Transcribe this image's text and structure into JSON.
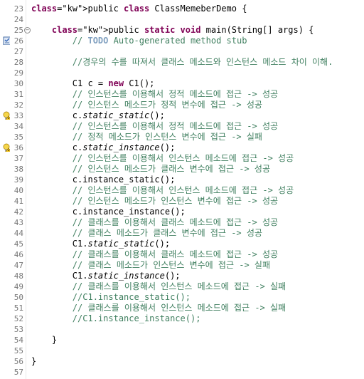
{
  "lines": [
    {
      "n": "23",
      "t": "public class ClassMemeberDemo {"
    },
    {
      "n": "24",
      "t": ""
    },
    {
      "n": "25",
      "t": "    public static void main(String[] args) {"
    },
    {
      "n": "26",
      "t": "        // TODO Auto-generated method stub"
    },
    {
      "n": "27",
      "t": ""
    },
    {
      "n": "28",
      "t": "        //경우의 수를 따져서 클래스 메소드와 인스턴스 메소드 차이 이해."
    },
    {
      "n": "29",
      "t": ""
    },
    {
      "n": "30",
      "t": "        C1 c = new C1();"
    },
    {
      "n": "31",
      "t": "        // 인스턴스를 이용해서 정적 메소드에 접근 -> 성공"
    },
    {
      "n": "32",
      "t": "        // 인스턴스 메소드가 정적 변수에 접근 -> 성공"
    },
    {
      "n": "33",
      "t": "        c.static_static();"
    },
    {
      "n": "34",
      "t": "        // 인스턴스를 이용해서 정적 메소드에 접근 -> 성공"
    },
    {
      "n": "35",
      "t": "        // 정적 메소드가 인스턴스 변수에 접근 -> 실패"
    },
    {
      "n": "36",
      "t": "        c.static_instance();"
    },
    {
      "n": "37",
      "t": "        // 인스턴스를 이용해서 인스턴스 메소드에 접근 -> 성공"
    },
    {
      "n": "38",
      "t": "        // 인스턴스 메소드가 클래스 변수에 접근 -> 성공"
    },
    {
      "n": "39",
      "t": "        c.instance_static();"
    },
    {
      "n": "40",
      "t": "        // 인스턴스를 이용해서 인스턴스 메소드에 접근 -> 성공"
    },
    {
      "n": "41",
      "t": "        // 인스턴스 메소드가 인스턴스 변수에 접근 -> 성공"
    },
    {
      "n": "42",
      "t": "        c.instance_instance();"
    },
    {
      "n": "43",
      "t": "        // 클래스를 이용해서 클래스 메소드에 접근 -> 성공"
    },
    {
      "n": "44",
      "t": "        // 클래스 메소드가 클래스 변수에 접근 -> 성공"
    },
    {
      "n": "45",
      "t": "        C1.static_static();"
    },
    {
      "n": "46",
      "t": "        // 클래스를 이용해서 클래스 메소드에 접근 -> 성공"
    },
    {
      "n": "47",
      "t": "        // 클래스 메소드가 인스턴스 변수에 접근 -> 실패"
    },
    {
      "n": "48",
      "t": "        C1.static_instance();"
    },
    {
      "n": "49",
      "t": "        // 클래스를 이용해서 인스턴스 메소드에 접근 -> 실패"
    },
    {
      "n": "50",
      "t": "        //C1.instance_static();"
    },
    {
      "n": "51",
      "t": "        // 클래스를 이용해서 인스턴스 메소드에 접근 -> 실패"
    },
    {
      "n": "52",
      "t": "        //C1.instance_instance();"
    },
    {
      "n": "53",
      "t": ""
    },
    {
      "n": "54",
      "t": "    }"
    },
    {
      "n": "55",
      "t": ""
    },
    {
      "n": "56",
      "t": "}"
    },
    {
      "n": "57",
      "t": ""
    }
  ],
  "colors": {
    "keyword": "#7f0055",
    "comment": "#3f7f5f",
    "todo": "#7f9fbf",
    "line_number": "#787878"
  },
  "icons": {
    "line_26": "task-marker-icon",
    "line_33": "warning-lightbulb-icon",
    "line_36": "warning-lightbulb-icon",
    "line_25": "fold-collapse-icon"
  }
}
